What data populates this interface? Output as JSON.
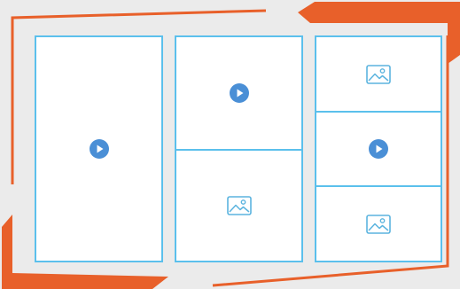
{
  "palette": {
    "background": "#ebebeb",
    "frame_orange": "#e8602a",
    "tile_border": "#5bc0ec",
    "tile_fill": "#ffffff",
    "play_icon": "#4a8fd6",
    "image_icon": "#5bb4df"
  },
  "gallery": {
    "columns": [
      {
        "tiles": [
          {
            "media": "play-icon"
          }
        ]
      },
      {
        "tiles": [
          {
            "media": "play-icon"
          },
          {
            "media": "image-icon"
          }
        ]
      },
      {
        "tiles": [
          {
            "media": "image-icon"
          },
          {
            "media": "play-icon"
          },
          {
            "media": "image-icon"
          }
        ]
      }
    ]
  }
}
